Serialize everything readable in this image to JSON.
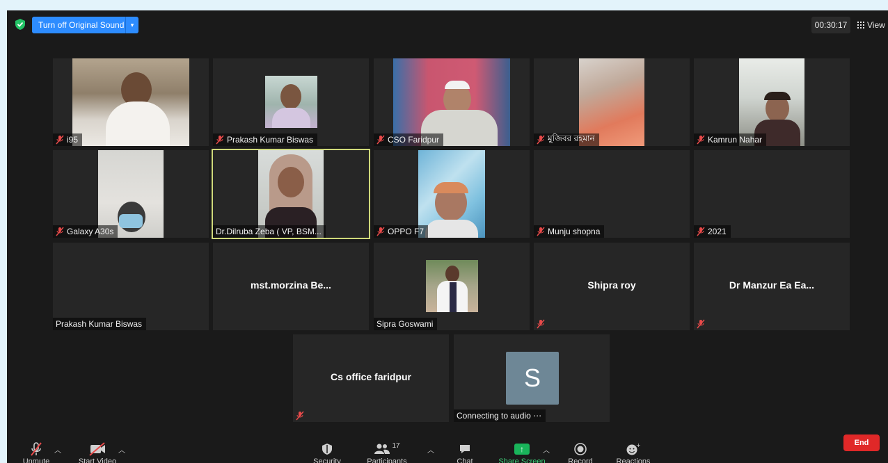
{
  "topbar": {
    "original_sound_label": "Turn off Original Sound",
    "timer": "00:30:17",
    "view_label": "View"
  },
  "participants": [
    {
      "name": "i95",
      "muted": true
    },
    {
      "name": "Prakash Kumar Biswas",
      "muted": true
    },
    {
      "name": "CSO Faridpur",
      "muted": true
    },
    {
      "name": "মুজিবর রহমান",
      "muted": true
    },
    {
      "name": "Kamrun Nahar",
      "muted": true
    },
    {
      "name": "Galaxy A30s",
      "muted": true
    },
    {
      "name": "Dr.Dilruba Zeba ( VP, BSM...",
      "muted": false,
      "active_speaker": true
    },
    {
      "name": "OPPO F7",
      "muted": true
    },
    {
      "name": "Munju shopna",
      "muted": true
    },
    {
      "name": "2021",
      "muted": true
    },
    {
      "name": "Prakash Kumar Biswas",
      "muted": false
    },
    {
      "name": "mst.morzina  Be...",
      "muted": false
    },
    {
      "name": "Sipra Goswami",
      "muted": false
    },
    {
      "name": "Shipra roy",
      "muted": true
    },
    {
      "name": "Dr Manzur Ea Ea...",
      "muted": true
    },
    {
      "name": "Cs office faridpur",
      "muted": true
    },
    {
      "name": "Connecting to audio ⋯",
      "avatar_letter": "S"
    }
  ],
  "toolbar": {
    "unmute": "Unmute",
    "start_video": "Start Video",
    "security": "Security",
    "participants": "Participants",
    "participants_count": "17",
    "chat": "Chat",
    "share_screen": "Share Screen",
    "record": "Record",
    "reactions": "Reactions",
    "end": "End"
  },
  "colors": {
    "accent_blue": "#2d8cff",
    "share_green": "#19b45a",
    "end_red": "#e02828",
    "active_border": "#cfd97a",
    "muted_red": "#e84a4a"
  }
}
